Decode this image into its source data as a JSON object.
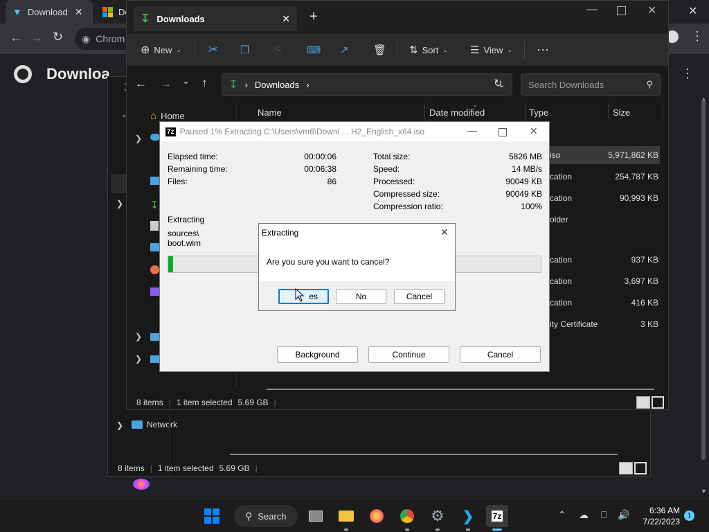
{
  "chrome": {
    "tabs": [
      {
        "label": "Download"
      },
      {
        "label": "Do"
      }
    ],
    "omnibox_text": "Chrom",
    "page_heading": "Downloa"
  },
  "back_explorer": {
    "nav": {
      "network": "Network"
    },
    "status": {
      "items": "8 items",
      "selected": "1 item selected",
      "size": "5.69 GB"
    }
  },
  "explorer": {
    "tab_title": "Downloads",
    "toolbar": {
      "new": "New",
      "sort": "Sort",
      "view": "View"
    },
    "address": {
      "crumb": "Downloads"
    },
    "search_placeholder": "Search Downloads",
    "nav": {
      "home": "Home"
    },
    "columns": {
      "name": "Name",
      "date": "Date modified",
      "type": "Type",
      "size": "Size"
    },
    "rows": [
      {
        "type": "iso",
        "size": "5,971,862 KB"
      },
      {
        "type": "cation",
        "size": "254,787 KB"
      },
      {
        "type": "cation",
        "size": "90,993 KB"
      },
      {
        "type": "older",
        "size": ""
      },
      {
        "type": "cation",
        "size": "937 KB"
      },
      {
        "type": "cation",
        "size": "3,697 KB"
      },
      {
        "type": "cation",
        "size": "416 KB"
      },
      {
        "type": "ity Certificate",
        "size": "3 KB"
      }
    ],
    "status": {
      "items": "8 items",
      "selected": "1 item selected",
      "size": "5.69 GB"
    }
  },
  "sevenzip": {
    "title": "Paused 1% Extracting C:\\Users\\vm6\\Downl ... H2_English_x64.iso",
    "left": [
      {
        "label": "Elapsed time:",
        "value": "00:00:06"
      },
      {
        "label": "Remaining time:",
        "value": "00:06:38"
      },
      {
        "label": "Files:",
        "value": "86"
      }
    ],
    "right": [
      {
        "label": "Total size:",
        "value": "5826 MB"
      },
      {
        "label": "Speed:",
        "value": "14 MB/s"
      },
      {
        "label": "Processed:",
        "value": "90049 KB"
      },
      {
        "label": "Compressed size:",
        "value": "90049 KB"
      },
      {
        "label": "Compression ratio:",
        "value": "100%"
      }
    ],
    "status_label": "Extracting",
    "current_path": "sources\\",
    "current_file": "boot.wim",
    "progress_percent": 1,
    "buttons": {
      "background": "Background",
      "continue": "Continue",
      "cancel": "Cancel"
    }
  },
  "confirm_dialog": {
    "title": "Extracting",
    "message": "Are you sure you want to cancel?",
    "buttons": {
      "yes": "es",
      "no": "No",
      "cancel": "Cancel"
    }
  },
  "taskbar": {
    "search_label": "Search",
    "time": "6:36 AM",
    "date": "7/22/2023",
    "notification_count": "1",
    "sevenzip_label": "7z"
  },
  "colors": {
    "progress": "#06b025",
    "accent": "#0078d4",
    "download_green": "#3fb950"
  }
}
